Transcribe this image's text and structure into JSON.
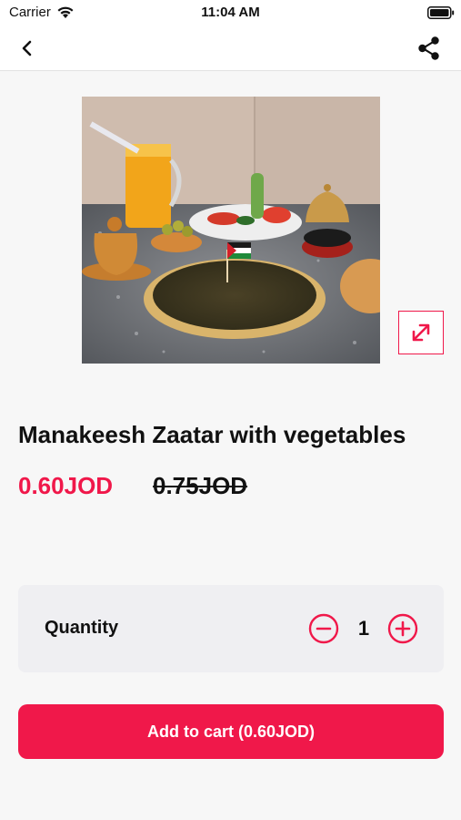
{
  "status_bar": {
    "carrier": "Carrier",
    "time": "11:04 AM"
  },
  "nav": {
    "back_icon": "chevron-left-icon",
    "share_icon": "share-icon"
  },
  "product": {
    "title": "Manakeesh Zaatar with vegetables",
    "price": "0.60JOD",
    "old_price": "0.75JOD",
    "expand_icon": "expand-icon"
  },
  "quantity": {
    "label": "Quantity",
    "value": "1"
  },
  "cart_button": {
    "label": "Add to cart (0.60JOD)"
  },
  "colors": {
    "accent": "#f0184a",
    "background": "#f7f7f7",
    "card": "#efeff2"
  }
}
